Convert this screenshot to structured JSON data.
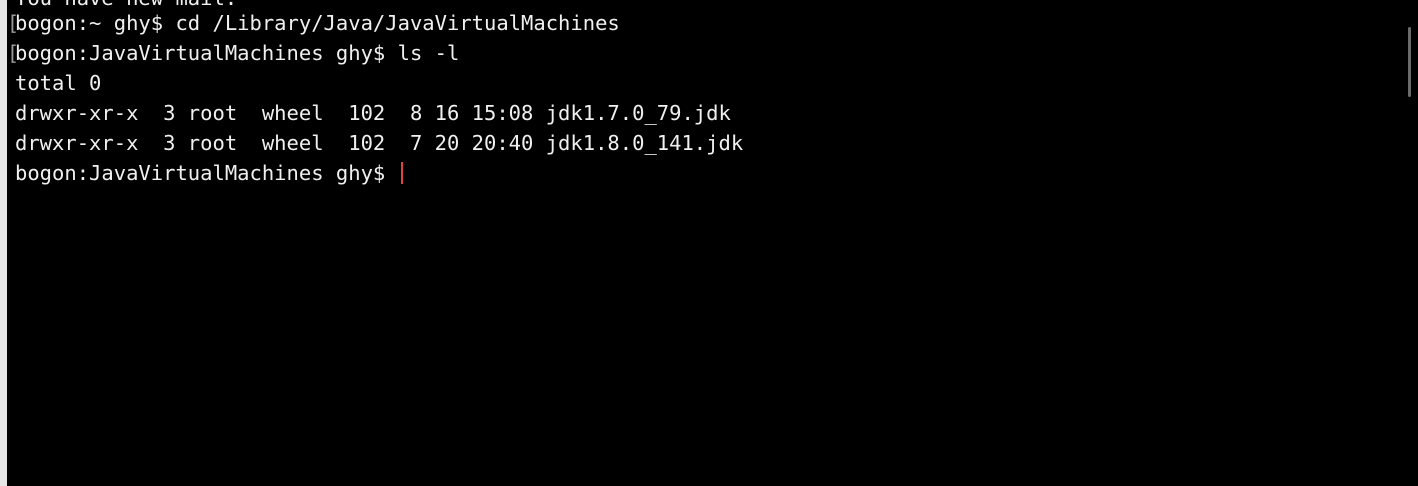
{
  "terminal": {
    "lines": [
      "You have new mail.",
      "bogon:~ ghy$ cd /Library/Java/JavaVirtualMachines",
      "bogon:JavaVirtualMachines ghy$ ls -l",
      "total 0",
      "drwxr-xr-x  3 root  wheel  102  8 16 15:08 jdk1.7.0_79.jdk",
      "drwxr-xr-x  3 root  wheel  102  7 20 20:40 jdk1.8.0_141.jdk",
      "bogon:JavaVirtualMachines ghy$ "
    ],
    "cursor_color": "#e0443a"
  }
}
